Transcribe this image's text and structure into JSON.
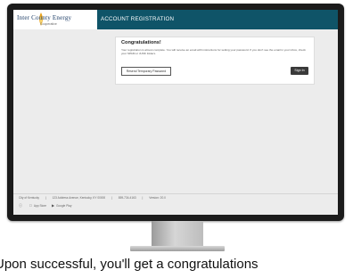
{
  "header": {
    "logo_text": "Inter County Energy",
    "logo_sub": "Cooperative",
    "title": "ACCOUNT REGISTRATION"
  },
  "card": {
    "heading": "Congratulations!",
    "body": "Your registration is almost complete. You will receive an email with instructions for setting your password. If you don't see the email in your inbox, check your SPAM or JUNK folders.",
    "resend_label": "Resend Temporary Password",
    "signin_label": "Sign In"
  },
  "footer": {
    "links": [
      "City of Kentucky",
      "|",
      "123 Address Avenue, Kentucky, KY 00000",
      "|",
      "859-734-4163",
      "|",
      "Version: 20.0"
    ],
    "apps": [
      {
        "icon": "info-icon",
        "label": ""
      },
      {
        "icon": "apple-icon",
        "label": "App Store"
      },
      {
        "icon": "play-icon",
        "label": "Google Play"
      }
    ]
  },
  "caption": "Upon successful, you'll get a congratulations"
}
